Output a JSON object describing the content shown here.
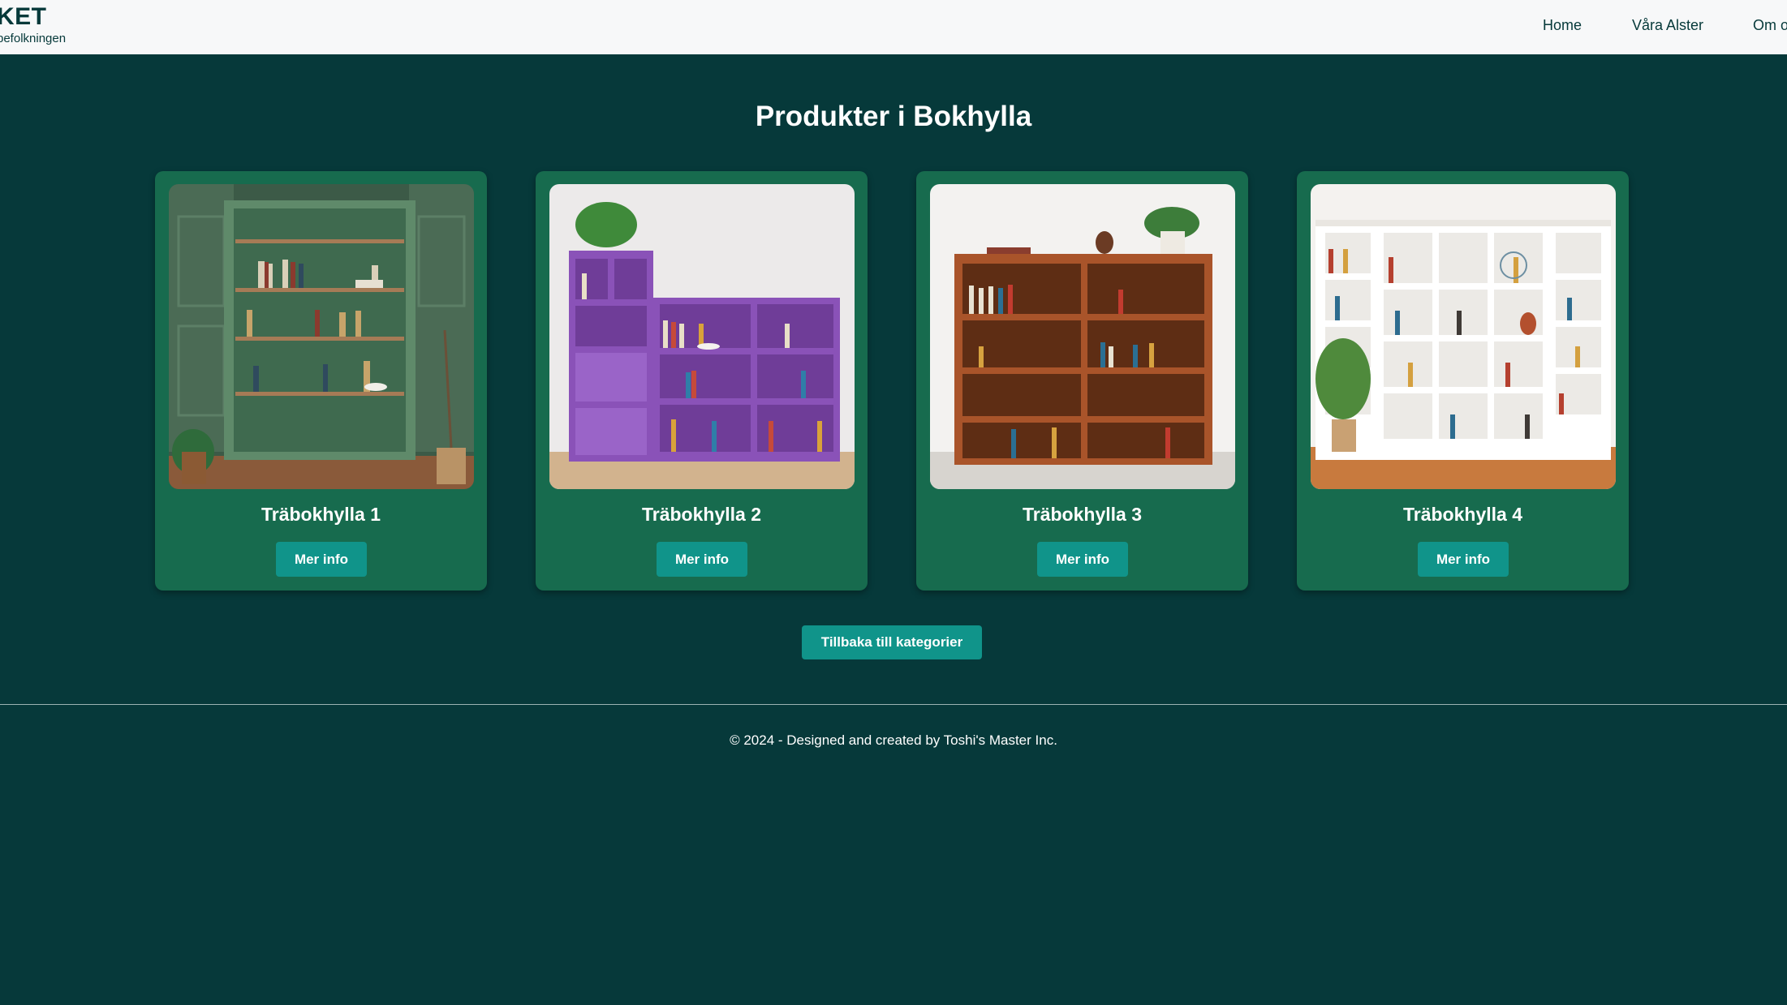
{
  "header": {
    "logo_title": "KET",
    "logo_subtitle": "befolkningen",
    "nav": [
      {
        "label": "Home"
      },
      {
        "label": "Våra Alster"
      },
      {
        "label": "Om o"
      }
    ]
  },
  "main": {
    "title": "Produkter i Bokhylla",
    "products": [
      {
        "name": "Träbokhylla 1",
        "button": "Mer info",
        "image": "green-bookshelf-photo"
      },
      {
        "name": "Träbokhylla 2",
        "button": "Mer info",
        "image": "purple-bookshelf-photo"
      },
      {
        "name": "Träbokhylla 3",
        "button": "Mer info",
        "image": "wooden-bookshelf-photo"
      },
      {
        "name": "Träbokhylla 4",
        "button": "Mer info",
        "image": "white-bookshelf-photo"
      }
    ],
    "back_button": "Tillbaka till kategorier"
  },
  "footer": {
    "text": "© 2024 - Designed and created by Toshi's Master Inc."
  },
  "colors": {
    "background": "#06393a",
    "header_bg": "#f7f8f9",
    "card_bg": "#176b4e",
    "button_bg": "#10948a",
    "text_light": "#ffffff",
    "text_dark": "#06393a"
  }
}
